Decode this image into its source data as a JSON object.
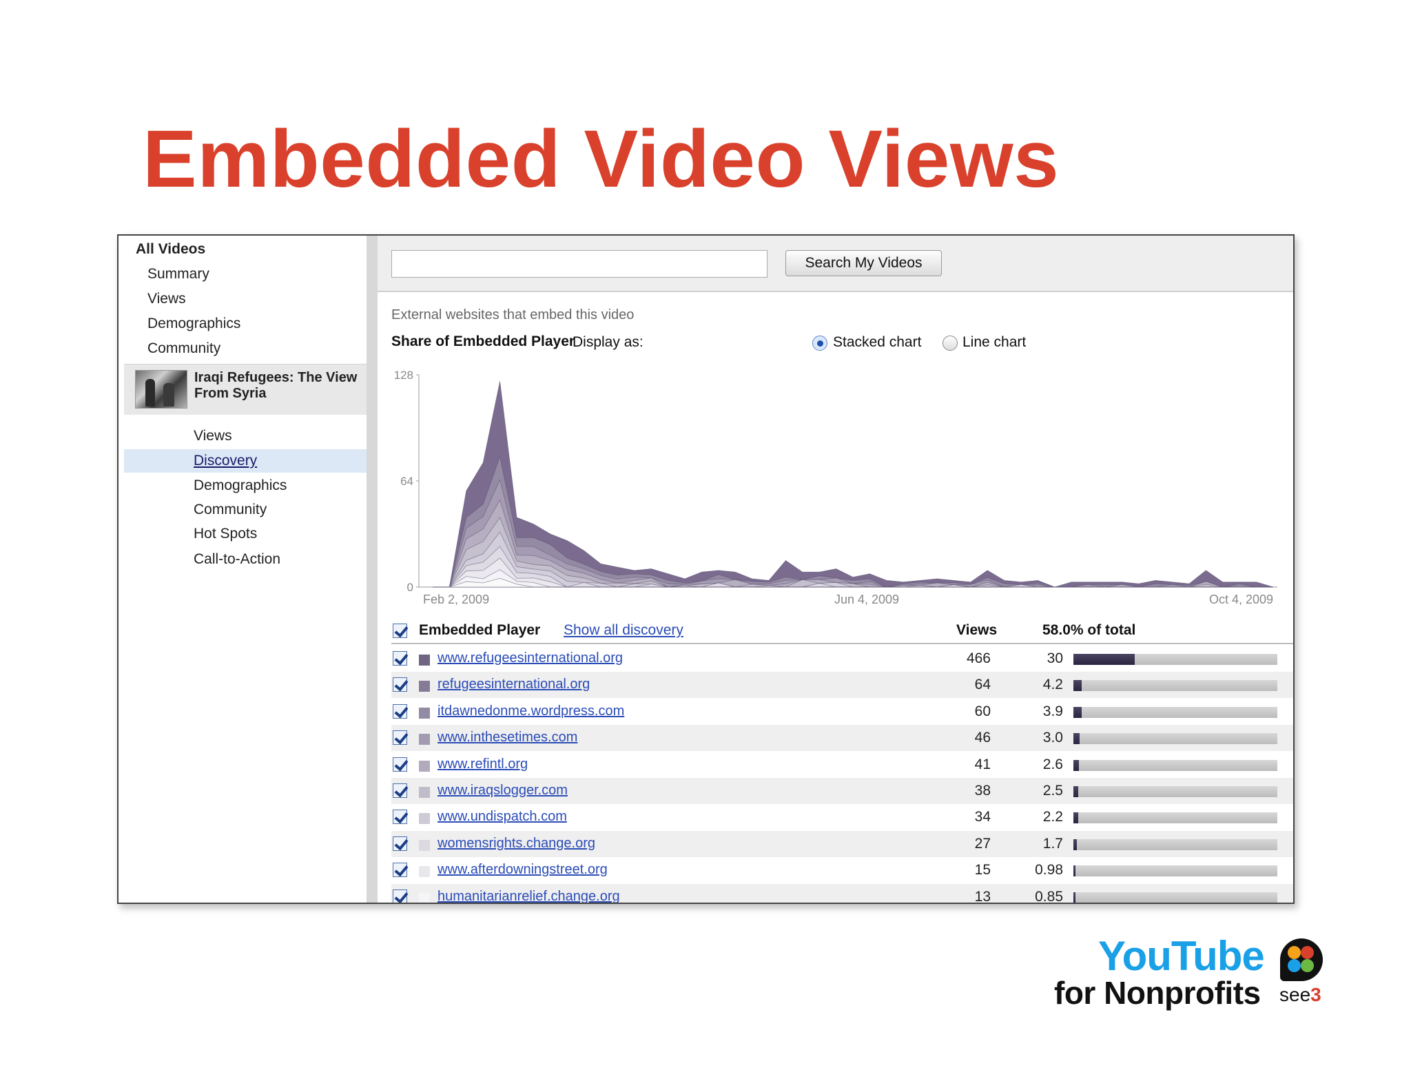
{
  "slide": {
    "title": "Embedded Video Views"
  },
  "sidebar": {
    "all_videos": "All Videos",
    "top_items": [
      {
        "label": "Summary"
      },
      {
        "label": "Views"
      },
      {
        "label": "Demographics"
      },
      {
        "label": "Community"
      }
    ],
    "video_title": "Iraqi Refugees: The View From Syria",
    "sub_items": [
      {
        "label": "Views",
        "active": false
      },
      {
        "label": "Discovery",
        "active": true
      },
      {
        "label": "Demographics",
        "active": false
      },
      {
        "label": "Community",
        "active": false
      },
      {
        "label": "Hot Spots",
        "active": false
      },
      {
        "label": "Call-to-Action",
        "active": false
      }
    ]
  },
  "search": {
    "value": "",
    "button_label": "Search My Videos"
  },
  "section": {
    "caption": "External websites that embed this video",
    "share_label": "Share of Embedded Player",
    "display_as": "Display as:",
    "option_stacked": "Stacked chart",
    "option_line": "Line chart",
    "selected": "stacked"
  },
  "chart_data": {
    "type": "area",
    "stacked": true,
    "y_ticks": [
      "128",
      "64",
      "0"
    ],
    "ylim": [
      0,
      128
    ],
    "x_tick_labels": [
      "Feb 2, 2009",
      "Jun 4, 2009",
      "Oct 4, 2009"
    ],
    "x_range": [
      "2009-02-02",
      "2009-10-04"
    ],
    "colors": [
      "#7a6b8f",
      "#948aa4",
      "#a59cb3",
      "#b6afc1",
      "#c5c0cd",
      "#d2cedb",
      "#dedbe5",
      "#ebe9ef",
      "#f4f3f7",
      "#fafafa"
    ],
    "series": [
      {
        "values": [
          0,
          0,
          5,
          10,
          26,
          7,
          3,
          2,
          3,
          3,
          2,
          2,
          1,
          2,
          2,
          3,
          3,
          1,
          1,
          1,
          1,
          5,
          1,
          1,
          2,
          1,
          2,
          1,
          1,
          1,
          1,
          1,
          1,
          3,
          1,
          1,
          2,
          0,
          1,
          1,
          1,
          1,
          1,
          1,
          1,
          1,
          4,
          1,
          1,
          1,
          0
        ]
      },
      {
        "values": [
          0,
          0,
          2,
          3,
          8,
          3,
          2,
          2,
          1,
          1,
          1,
          1,
          1,
          1,
          1,
          1,
          0,
          1,
          0,
          1,
          1,
          1,
          0,
          1,
          0,
          1,
          1,
          0,
          1,
          1,
          0,
          1,
          0,
          1,
          1,
          0,
          1,
          0,
          0,
          0,
          1,
          0,
          0,
          1,
          0,
          1,
          0,
          0,
          1,
          0,
          0
        ]
      },
      {
        "values": [
          0,
          0,
          2,
          3,
          7,
          3,
          2,
          1,
          1,
          1,
          1,
          1,
          1,
          0,
          1,
          0,
          1,
          1,
          0,
          0,
          1,
          1,
          0,
          0,
          1,
          0,
          1,
          0,
          0,
          1,
          0,
          0,
          1,
          1,
          0,
          0,
          1,
          0,
          0,
          1,
          0,
          0,
          0,
          0,
          1,
          0,
          0,
          0,
          1,
          0,
          0
        ]
      },
      {
        "values": [
          0,
          0,
          2,
          3,
          6,
          2,
          2,
          1,
          1,
          1,
          1,
          0,
          1,
          1,
          0,
          1,
          0,
          0,
          1,
          0,
          0,
          1,
          0,
          1,
          0,
          0,
          1,
          0,
          0,
          0,
          1,
          0,
          0,
          1,
          0,
          0,
          1,
          0,
          0,
          0,
          0,
          1,
          0,
          0,
          0,
          0,
          1,
          0,
          0,
          0,
          0
        ]
      },
      {
        "values": [
          0,
          0,
          2,
          3,
          5,
          2,
          1,
          1,
          1,
          1,
          0,
          1,
          0,
          1,
          0,
          0,
          1,
          0,
          0,
          1,
          0,
          0,
          1,
          0,
          0,
          1,
          0,
          0,
          1,
          0,
          0,
          0,
          0,
          1,
          0,
          0,
          0,
          0,
          0,
          0,
          0,
          0,
          0,
          0,
          0,
          0,
          1,
          0,
          0,
          0,
          0
        ]
      },
      {
        "values": [
          0,
          0,
          1,
          2,
          5,
          2,
          1,
          1,
          1,
          0,
          1,
          0,
          1,
          0,
          0,
          1,
          0,
          0,
          0,
          0,
          1,
          0,
          0,
          0,
          1,
          0,
          0,
          0,
          0,
          1,
          0,
          0,
          0,
          0,
          0,
          1,
          0,
          0,
          0,
          0,
          0,
          0,
          0,
          0,
          0,
          0,
          0,
          0,
          0,
          0,
          0
        ]
      },
      {
        "values": [
          0,
          0,
          1,
          2,
          4,
          2,
          1,
          1,
          0,
          1,
          0,
          0,
          0,
          1,
          0,
          0,
          0,
          1,
          0,
          0,
          0,
          0,
          0,
          1,
          0,
          0,
          0,
          0,
          0,
          0,
          0,
          1,
          0,
          0,
          0,
          0,
          0,
          0,
          0,
          0,
          0,
          0,
          0,
          0,
          0,
          0,
          0,
          0,
          0,
          0,
          0
        ]
      },
      {
        "values": [
          0,
          0,
          1,
          2,
          4,
          1,
          1,
          1,
          0,
          0,
          0,
          0,
          0,
          0,
          0,
          0,
          0,
          0,
          0,
          0,
          0,
          0,
          0,
          0,
          0,
          0,
          0,
          0,
          0,
          0,
          0,
          0,
          0,
          0,
          0,
          0,
          0,
          0,
          0,
          0,
          0,
          0,
          0,
          0,
          0,
          0,
          0,
          0,
          0,
          0,
          0
        ]
      },
      {
        "values": [
          0,
          0,
          1,
          1,
          3,
          1,
          1,
          0,
          0,
          0,
          0,
          0,
          0,
          0,
          0,
          0,
          0,
          0,
          0,
          0,
          0,
          0,
          0,
          0,
          0,
          0,
          0,
          0,
          0,
          0,
          0,
          0,
          0,
          0,
          0,
          0,
          0,
          0,
          0,
          0,
          0,
          0,
          0,
          0,
          0,
          0,
          0,
          0,
          0,
          0,
          0
        ]
      },
      {
        "values": [
          0,
          0,
          1,
          1,
          3,
          1,
          0,
          0,
          0,
          0,
          0,
          0,
          0,
          0,
          0,
          0,
          0,
          0,
          0,
          0,
          0,
          0,
          0,
          0,
          0,
          0,
          0,
          0,
          0,
          0,
          0,
          0,
          0,
          0,
          0,
          0,
          0,
          0,
          0,
          0,
          0,
          0,
          0,
          0,
          0,
          0,
          0,
          0,
          0,
          0,
          0
        ]
      }
    ],
    "top_outline": [
      0,
      0,
      58,
      75,
      124,
      42,
      38,
      32,
      28,
      22,
      14,
      12,
      10,
      11,
      8,
      5,
      9,
      10,
      9,
      5,
      4,
      16,
      9,
      9,
      11,
      6,
      8,
      4,
      3,
      4,
      5,
      4,
      3,
      10,
      4,
      3,
      4,
      2,
      3,
      3,
      3,
      3,
      2,
      4,
      3,
      2,
      10,
      3,
      3,
      3,
      2
    ]
  },
  "table": {
    "header_label": "Embedded Player",
    "header_link": "Show all discovery",
    "col_views": "Views",
    "col_pct": "58.0% of total",
    "rows": [
      {
        "site": "www.refugeesinternational.org",
        "views": "466",
        "pct": "30",
        "share": 0.3,
        "color": "#6f6582"
      },
      {
        "site": "refugeesinternational.org",
        "views": "64",
        "pct": "4.2",
        "share": 0.042,
        "color": "#857b96"
      },
      {
        "site": "itdawnedonme.wordpress.com",
        "views": "60",
        "pct": "3.9",
        "share": 0.039,
        "color": "#938aa3"
      },
      {
        "site": "www.inthesetimes.com",
        "views": "46",
        "pct": "3.0",
        "share": 0.03,
        "color": "#a39bb1"
      },
      {
        "site": "www.refintl.org",
        "views": "41",
        "pct": "2.6",
        "share": 0.026,
        "color": "#b1abbd"
      },
      {
        "site": "www.iraqslogger.com",
        "views": "38",
        "pct": "2.5",
        "share": 0.025,
        "color": "#c1bcca"
      },
      {
        "site": "www.undispatch.com",
        "views": "34",
        "pct": "2.2",
        "share": 0.022,
        "color": "#cfcbd6"
      },
      {
        "site": "womensrights.change.org",
        "views": "27",
        "pct": "1.7",
        "share": 0.017,
        "color": "#dcd9e1"
      },
      {
        "site": "www.afterdowningstreet.org",
        "views": "15",
        "pct": "0.98",
        "share": 0.0098,
        "color": "#e9e7ec"
      },
      {
        "site": "humanitarianrelief.change.org",
        "views": "13",
        "pct": "0.85",
        "share": 0.0085,
        "color": "#f5f4f7"
      }
    ]
  },
  "logo": {
    "youtube": "YouTube",
    "for_nonprofits": "for Nonprofits",
    "see3_a": "see",
    "see3_b": "3"
  }
}
